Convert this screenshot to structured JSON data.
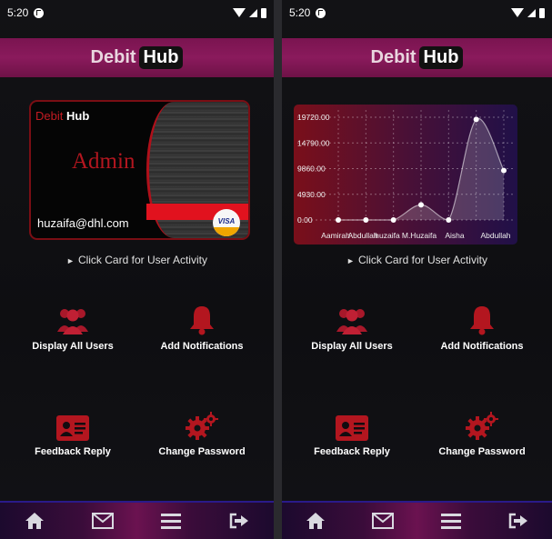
{
  "status_bar": {
    "time": "5:20"
  },
  "header": {
    "brand_left": "Debit",
    "brand_right": "Hub"
  },
  "debit_card": {
    "brand_left": "Debit",
    "brand_right": "Hub",
    "role": "Admin",
    "email": "huzaifa@dhl.com",
    "network": "VISA"
  },
  "hint": {
    "text": "Click Card for User Activity"
  },
  "actions": [
    {
      "label": "Display All Users",
      "icon": "users-icon"
    },
    {
      "label": "Add Notifications",
      "icon": "bell-icon"
    },
    {
      "label": "Feedback Reply",
      "icon": "id-card-icon"
    },
    {
      "label": "Change Password",
      "icon": "gears-icon"
    }
  ],
  "nav": {
    "items": [
      {
        "icon": "home-icon"
      },
      {
        "icon": "envelope-icon"
      },
      {
        "icon": "menu-icon"
      },
      {
        "icon": "logout-icon"
      }
    ]
  },
  "colors": {
    "header": "#7a1450",
    "accent_red": "#b3161f",
    "card_stripe": "#e1121e"
  },
  "chart_data": {
    "type": "area",
    "categories": [
      "Aamirah",
      "Abdullah",
      "huzaifa",
      "M.Huzaifa",
      "Aisha",
      "Abdullah"
    ],
    "values": [
      0,
      0,
      0,
      2900,
      0,
      19300,
      9500
    ],
    "y_ticks": [
      "19720.00",
      "14790.00",
      "9860.00",
      "4930.00",
      "0.00"
    ],
    "ylim": [
      0,
      19720
    ],
    "grid": true
  }
}
